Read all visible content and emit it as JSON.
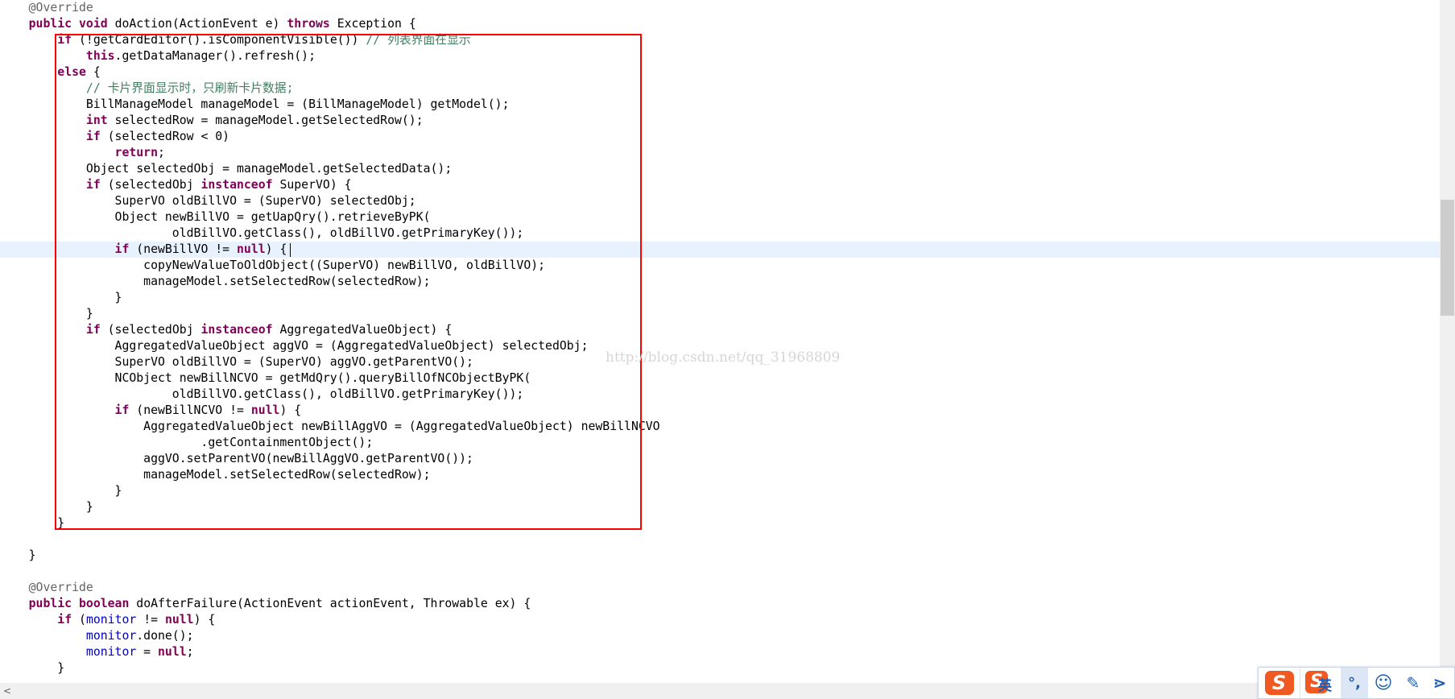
{
  "editor": {
    "lines": [
      [
        {
          "t": "    ",
          "c": "txt"
        },
        {
          "t": "@Override",
          "c": "ann"
        }
      ],
      [
        {
          "t": "    ",
          "c": "txt"
        },
        {
          "t": "public",
          "c": "kw"
        },
        {
          "t": " ",
          "c": "txt"
        },
        {
          "t": "void",
          "c": "kw"
        },
        {
          "t": " doAction(ActionEvent e) ",
          "c": "txt"
        },
        {
          "t": "throws",
          "c": "kw"
        },
        {
          "t": " Exception {",
          "c": "txt"
        }
      ],
      [
        {
          "t": "        ",
          "c": "txt"
        },
        {
          "t": "if",
          "c": "kw"
        },
        {
          "t": " (!getCardEditor().isComponentVisible()) ",
          "c": "txt"
        },
        {
          "t": "// 列表界面在显示",
          "c": "cmt"
        }
      ],
      [
        {
          "t": "            ",
          "c": "txt"
        },
        {
          "t": "this",
          "c": "kw"
        },
        {
          "t": ".getDataManager().refresh();",
          "c": "txt"
        }
      ],
      [
        {
          "t": "        ",
          "c": "txt"
        },
        {
          "t": "else",
          "c": "kw"
        },
        {
          "t": " {",
          "c": "txt"
        }
      ],
      [
        {
          "t": "            ",
          "c": "txt"
        },
        {
          "t": "// 卡片界面显示时，只刷新卡片数据;",
          "c": "cmt"
        }
      ],
      [
        {
          "t": "            BillManageModel manageModel = (BillManageModel) getModel();",
          "c": "txt"
        }
      ],
      [
        {
          "t": "            ",
          "c": "txt"
        },
        {
          "t": "int",
          "c": "kw"
        },
        {
          "t": " selectedRow = manageModel.getSelectedRow();",
          "c": "txt"
        }
      ],
      [
        {
          "t": "            ",
          "c": "txt"
        },
        {
          "t": "if",
          "c": "kw"
        },
        {
          "t": " (selectedRow < 0)",
          "c": "txt"
        }
      ],
      [
        {
          "t": "                ",
          "c": "txt"
        },
        {
          "t": "return",
          "c": "kw"
        },
        {
          "t": ";",
          "c": "txt"
        }
      ],
      [
        {
          "t": "            Object selectedObj = manageModel.getSelectedData();",
          "c": "txt"
        }
      ],
      [
        {
          "t": "            ",
          "c": "txt"
        },
        {
          "t": "if",
          "c": "kw"
        },
        {
          "t": " (selectedObj ",
          "c": "txt"
        },
        {
          "t": "instanceof",
          "c": "kw"
        },
        {
          "t": " SuperVO) {",
          "c": "txt"
        }
      ],
      [
        {
          "t": "                SuperVO oldBillVO = (SuperVO) selectedObj;",
          "c": "txt"
        }
      ],
      [
        {
          "t": "                Object newBillVO = getUapQry().retrieveByPK(",
          "c": "txt"
        }
      ],
      [
        {
          "t": "                        oldBillVO.getClass(), oldBillVO.getPrimaryKey());",
          "c": "txt"
        }
      ],
      [
        {
          "t": "                ",
          "c": "txt"
        },
        {
          "t": "if",
          "c": "kw"
        },
        {
          "t": " (newBillVO != ",
          "c": "txt"
        },
        {
          "t": "null",
          "c": "kw"
        },
        {
          "t": ") {",
          "c": "txt"
        }
      ],
      [
        {
          "t": "                    copyNewValueToOldObject((SuperVO) newBillVO, oldBillVO);",
          "c": "txt"
        }
      ],
      [
        {
          "t": "                    manageModel.setSelectedRow(selectedRow);",
          "c": "txt"
        }
      ],
      [
        {
          "t": "                }",
          "c": "txt"
        }
      ],
      [
        {
          "t": "            }",
          "c": "txt"
        }
      ],
      [
        {
          "t": "            ",
          "c": "txt"
        },
        {
          "t": "if",
          "c": "kw"
        },
        {
          "t": " (selectedObj ",
          "c": "txt"
        },
        {
          "t": "instanceof",
          "c": "kw"
        },
        {
          "t": " AggregatedValueObject) {",
          "c": "txt"
        }
      ],
      [
        {
          "t": "                AggregatedValueObject aggVO = (AggregatedValueObject) selectedObj;",
          "c": "txt"
        }
      ],
      [
        {
          "t": "                SuperVO oldBillVO = (SuperVO) aggVO.getParentVO();",
          "c": "txt"
        }
      ],
      [
        {
          "t": "                NCObject newBillNCVO = getMdQry().queryBillOfNCObjectByPK(",
          "c": "txt"
        }
      ],
      [
        {
          "t": "                        oldBillVO.getClass(), oldBillVO.getPrimaryKey());",
          "c": "txt"
        }
      ],
      [
        {
          "t": "                ",
          "c": "txt"
        },
        {
          "t": "if",
          "c": "kw"
        },
        {
          "t": " (newBillNCVO != ",
          "c": "txt"
        },
        {
          "t": "null",
          "c": "kw"
        },
        {
          "t": ") {",
          "c": "txt"
        }
      ],
      [
        {
          "t": "                    AggregatedValueObject newBillAggVO = (AggregatedValueObject) newBillNCVO",
          "c": "txt"
        }
      ],
      [
        {
          "t": "                            .getContainmentObject();",
          "c": "txt"
        }
      ],
      [
        {
          "t": "                    aggVO.setParentVO(newBillAggVO.getParentVO());",
          "c": "txt"
        }
      ],
      [
        {
          "t": "                    manageModel.setSelectedRow(selectedRow);",
          "c": "txt"
        }
      ],
      [
        {
          "t": "                }",
          "c": "txt"
        }
      ],
      [
        {
          "t": "            }",
          "c": "txt"
        }
      ],
      [
        {
          "t": "        }",
          "c": "txt"
        }
      ],
      [
        {
          "t": "",
          "c": "txt"
        }
      ],
      [
        {
          "t": "    }",
          "c": "txt"
        }
      ],
      [
        {
          "t": "",
          "c": "txt"
        }
      ],
      [
        {
          "t": "    ",
          "c": "txt"
        },
        {
          "t": "@Override",
          "c": "ann"
        }
      ],
      [
        {
          "t": "    ",
          "c": "txt"
        },
        {
          "t": "public",
          "c": "kw"
        },
        {
          "t": " ",
          "c": "txt"
        },
        {
          "t": "boolean",
          "c": "kw"
        },
        {
          "t": " doAfterFailure(ActionEvent actionEvent, Throwable ex) {",
          "c": "txt"
        }
      ],
      [
        {
          "t": "        ",
          "c": "txt"
        },
        {
          "t": "if",
          "c": "kw"
        },
        {
          "t": " (",
          "c": "txt"
        },
        {
          "t": "monitor",
          "c": "fld"
        },
        {
          "t": " != ",
          "c": "txt"
        },
        {
          "t": "null",
          "c": "kw"
        },
        {
          "t": ") {",
          "c": "txt"
        }
      ],
      [
        {
          "t": "            ",
          "c": "txt"
        },
        {
          "t": "monitor",
          "c": "fld"
        },
        {
          "t": ".done();",
          "c": "txt"
        }
      ],
      [
        {
          "t": "            ",
          "c": "txt"
        },
        {
          "t": "monitor",
          "c": "fld"
        },
        {
          "t": " = ",
          "c": "txt"
        },
        {
          "t": "null",
          "c": "kw"
        },
        {
          "t": ";",
          "c": "txt"
        }
      ],
      [
        {
          "t": "        }",
          "c": "txt"
        }
      ]
    ],
    "current_line": 15
  },
  "watermark": "http://blog.csdn.net/qq_31968809",
  "scrollbar": {
    "left_arrow": "<"
  },
  "ime_toolbar": {
    "logo": "S",
    "mode_logo": "S",
    "language": "英",
    "punctuation": "°,",
    "emoji": "☺",
    "pen": "✎",
    "more": "⋗"
  },
  "colors": {
    "keyword": "#7f0055",
    "comment": "#3f7f5f",
    "annotation": "#646464",
    "field": "#0000c0",
    "highlight_box": "#ff0000",
    "current_line": "#e8f2fe",
    "ime_accent": "#f05a22"
  }
}
